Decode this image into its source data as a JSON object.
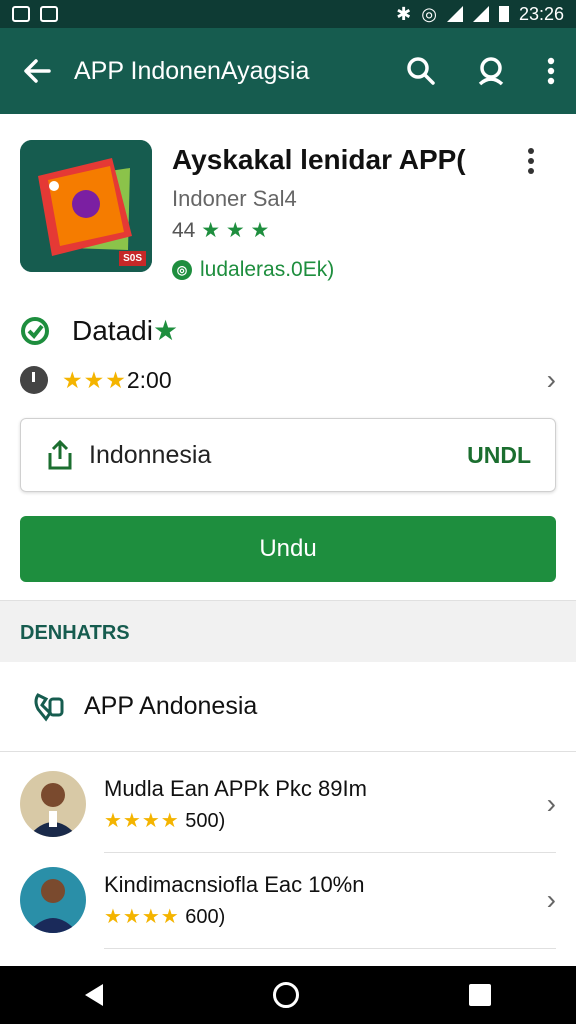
{
  "status_bar": {
    "time": "23:26"
  },
  "app_bar": {
    "title": "APP IndonenAyagsia"
  },
  "app": {
    "name": "Ayskakal lenidar APP(",
    "developer": "Indoner Sal4",
    "rating_text": "44",
    "rating_stars": "★ ★ ★",
    "downloads": "ludaleras.0Ek)",
    "icon_badge": "S0S"
  },
  "status_row": {
    "label": "Datadi",
    "star": "★"
  },
  "rating_row": {
    "stars": "★★★",
    "value": "2:00"
  },
  "country_selector": {
    "label": "Indonnesia",
    "action": "UNDL"
  },
  "primary_button": {
    "label": "Undu"
  },
  "section": {
    "title": "DENHATRS"
  },
  "section_row": {
    "label": "APP Andonesia"
  },
  "list": [
    {
      "title": "Mudla Ean APPk Pkc 89Im",
      "stars": "★★★★",
      "count": "500)"
    },
    {
      "title": "Kindimacnsiofla Eac 10%n",
      "stars": "★★★★",
      "count": "600)"
    }
  ],
  "colors": {
    "primary": "#165c4f",
    "status": "#0e3b34",
    "accent": "#1e8e3e",
    "star": "#f4b400"
  }
}
